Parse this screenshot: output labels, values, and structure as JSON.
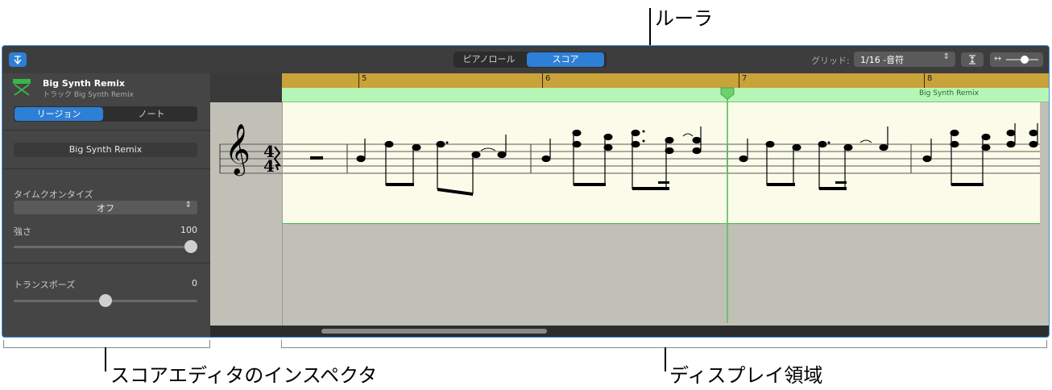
{
  "callouts": {
    "ruler": "ルーラ",
    "inspector": "スコアエディタのインスペクタ",
    "display": "ディスプレイ領域"
  },
  "toolbar": {
    "piano_roll": "ピアノロール",
    "score": "スコア",
    "grid_label": "グリッド:",
    "grid_value": "1/16 -音符"
  },
  "inspector": {
    "track_name": "Big Synth Remix",
    "track_sub": "トラック Big Synth Remix",
    "tab_region": "リージョン",
    "tab_note": "ノート",
    "region_name": "Big Synth Remix",
    "time_quantize_label": "タイムクオンタイズ",
    "time_quantize_value": "オフ",
    "strength_label": "強さ",
    "strength_value": "100",
    "strength_level": 1.0,
    "transpose_label": "トランスポーズ",
    "transpose_value": "0",
    "transpose_level": 0.5
  },
  "ruler": {
    "bars": [
      "5",
      "6",
      "7",
      "8"
    ],
    "region_label": "Big Synth Remix"
  },
  "score": {
    "time_signature": [
      "4",
      "4"
    ],
    "clef": "𝄞"
  },
  "colors": {
    "accent": "#2e7fd6",
    "ruler": "#c9a23a",
    "region": "#b6f5b6",
    "staff_bg": "#fbfbe9"
  }
}
